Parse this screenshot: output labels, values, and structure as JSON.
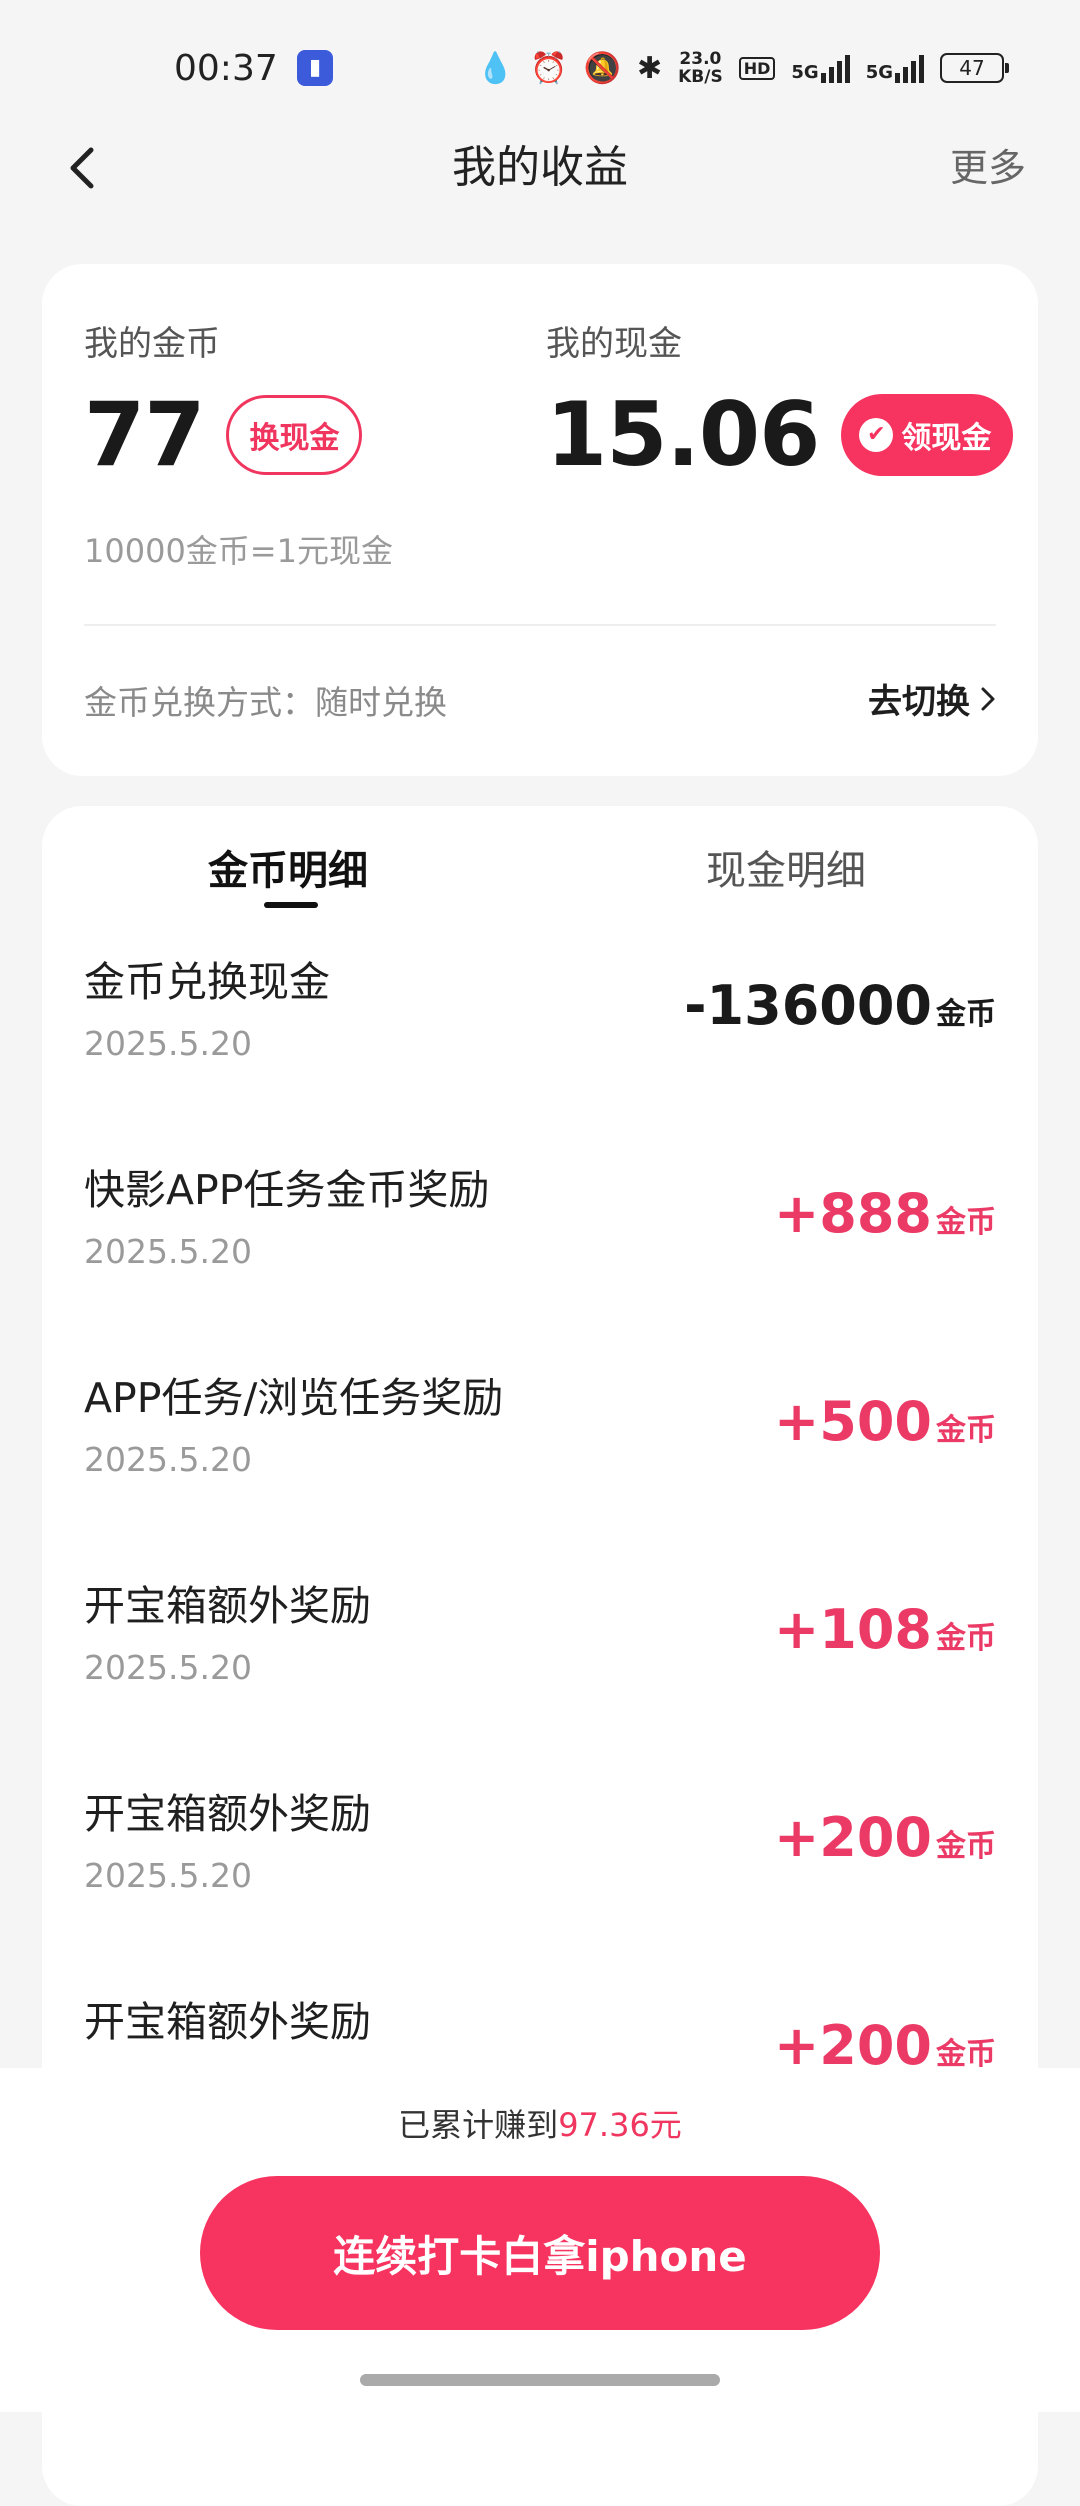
{
  "status_bar": {
    "time": "00:37",
    "net_speed_value": "23.0",
    "net_speed_unit": "KB/S",
    "hd_label": "HD",
    "signal1_label": "5G",
    "signal2_label": "5G",
    "battery": "47",
    "icons": [
      "app-icon",
      "drop-icon",
      "alarm-icon",
      "mute-bell-icon",
      "bluetooth-icon"
    ]
  },
  "header": {
    "title": "我的收益",
    "more_label": "更多"
  },
  "earnings": {
    "coins_label": "我的金币",
    "coins_value": "77",
    "exchange_button": "换现金",
    "cash_label": "我的现金",
    "cash_value": "15.06",
    "withdraw_button": "领现金",
    "rate_text": "10000金币=1元现金",
    "exchange_mode_text": "金币兑换方式：随时兑换",
    "switch_button": "去切换"
  },
  "tabs": {
    "coin_detail": "金币明细",
    "cash_detail": "现金明细"
  },
  "transactions": [
    {
      "title": "金币兑换现金",
      "date": "2025.5.20",
      "amount": "-136000",
      "unit": "金币",
      "type": "neg"
    },
    {
      "title": "快影APP任务金币奖励",
      "date": "2025.5.20",
      "amount": "+888",
      "unit": "金币",
      "type": "pos"
    },
    {
      "title": "APP任务/浏览任务奖励",
      "date": "2025.5.20",
      "amount": "+500",
      "unit": "金币",
      "type": "pos"
    },
    {
      "title": "开宝箱额外奖励",
      "date": "2025.5.20",
      "amount": "+108",
      "unit": "金币",
      "type": "pos"
    },
    {
      "title": "开宝箱额外奖励",
      "date": "2025.5.20",
      "amount": "+200",
      "unit": "金币",
      "type": "pos"
    },
    {
      "title": "开宝箱额外奖励",
      "date": "",
      "amount": "+200",
      "unit": "金币",
      "type": "pos"
    }
  ],
  "footer": {
    "total_prefix": "已累计赚到",
    "total_amount": "97.36元",
    "cta_button": "连续打卡白拿iphone"
  },
  "colors": {
    "accent": "#f7335f",
    "positive": "#ea3a65",
    "background": "#f5f5f5"
  }
}
